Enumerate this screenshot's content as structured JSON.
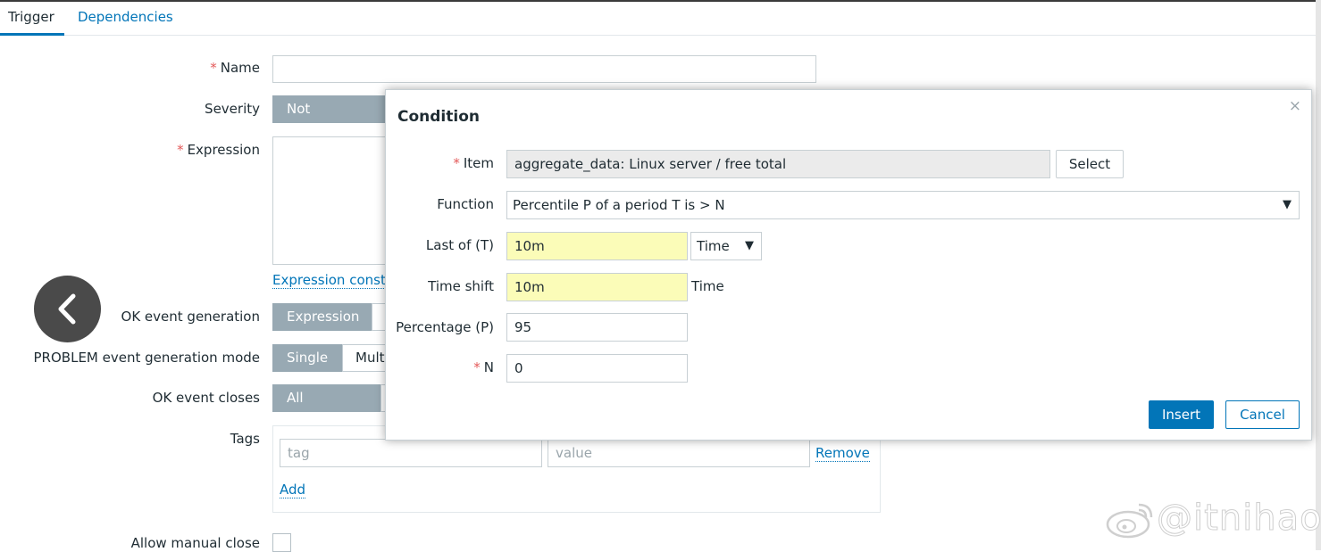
{
  "tabs": {
    "trigger": "Trigger",
    "dependencies": "Dependencies"
  },
  "form": {
    "name_label": "Name",
    "name_value": "",
    "severity_label": "Severity",
    "severity_selected": "Not classified",
    "expression_label": "Expression",
    "expression_constructor_link": "Expression constr",
    "ok_event_generation_label": "OK event generation",
    "ok_event_generation_selected": "Expression",
    "problem_mode_label": "PROBLEM event generation mode",
    "problem_mode_options": [
      "Single",
      "Mult"
    ],
    "ok_event_closes_label": "OK event closes",
    "ok_event_closes_selected": "All problems",
    "tags_label": "Tags",
    "tag_placeholder": "tag",
    "value_placeholder": "value",
    "remove_link": "Remove",
    "add_link": "Add",
    "allow_manual_close_label": "Allow manual close",
    "required_mark": "*"
  },
  "dialog": {
    "title": "Condition",
    "close_glyph": "×",
    "item_label": "Item",
    "item_value": "aggregate_data: Linux server / free total",
    "select_button": "Select",
    "function_label": "Function",
    "function_value": "Percentile P of a period T is > N",
    "last_of_label": "Last of (T)",
    "last_of_value": "10m",
    "last_of_unit": "Time",
    "time_shift_label": "Time shift",
    "time_shift_value": "10m",
    "time_shift_unit": "Time",
    "percentage_label": "Percentage (P)",
    "percentage_value": "95",
    "n_label": "N",
    "n_value": "0",
    "insert_button": "Insert",
    "cancel_button": "Cancel",
    "caret_glyph": "▼"
  },
  "icons": {
    "back": "chevron-left-icon",
    "close": "close-icon",
    "watermark": "weibo-logo-icon"
  },
  "colors": {
    "accent": "#0275b8",
    "highlight": "#fbfcb8",
    "segment_active": "#98a9b3",
    "required": "#e45959"
  },
  "watermark": {
    "text": "@itnihao"
  }
}
